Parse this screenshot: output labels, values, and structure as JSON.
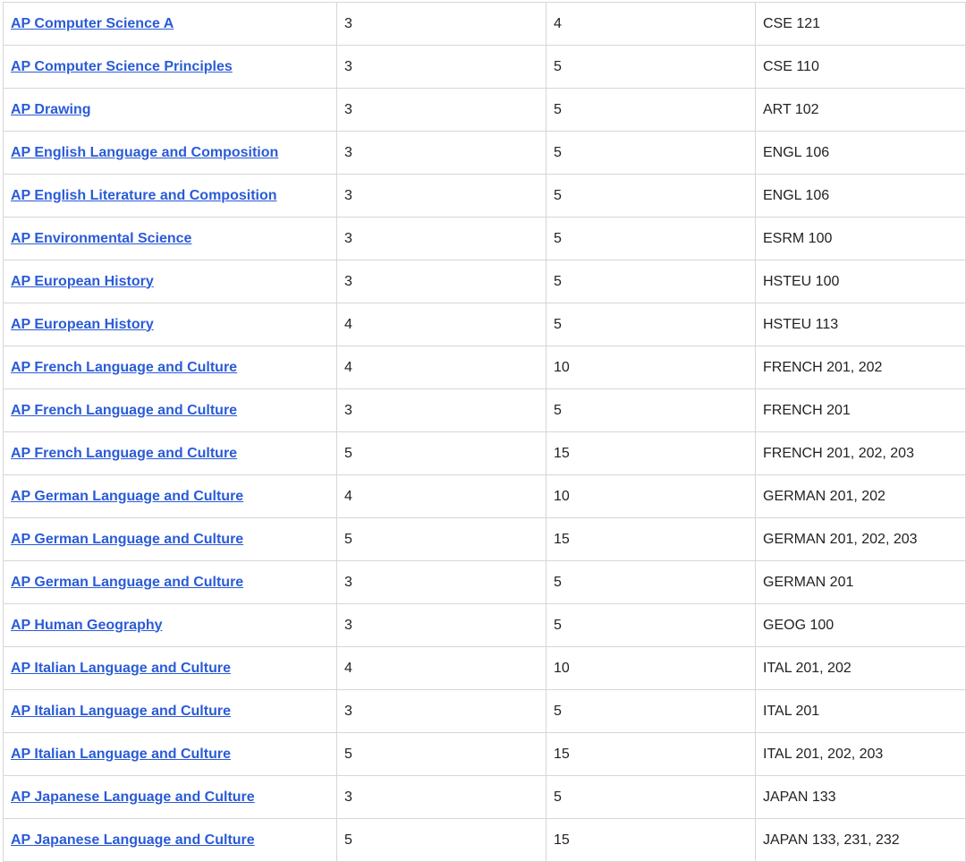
{
  "table": {
    "rows": [
      {
        "exam": "AP Computer Science A",
        "score": "3",
        "credits": "4",
        "courses": "CSE 121"
      },
      {
        "exam": "AP Computer Science Principles",
        "score": "3",
        "credits": "5",
        "courses": "CSE 110"
      },
      {
        "exam": "AP Drawing",
        "score": "3",
        "credits": "5",
        "courses": "ART 102"
      },
      {
        "exam": "AP English Language and Composition",
        "score": "3",
        "credits": "5",
        "courses": "ENGL 106"
      },
      {
        "exam": "AP English Literature and Composition",
        "score": "3",
        "credits": "5",
        "courses": "ENGL 106"
      },
      {
        "exam": "AP Environmental Science",
        "score": "3",
        "credits": "5",
        "courses": "ESRM 100"
      },
      {
        "exam": "AP European History",
        "score": "3",
        "credits": "5",
        "courses": "HSTEU 100"
      },
      {
        "exam": "AP European History",
        "score": "4",
        "credits": "5",
        "courses": "HSTEU 113"
      },
      {
        "exam": "AP French Language and Culture",
        "score": "4",
        "credits": "10",
        "courses": "FRENCH 201, 202"
      },
      {
        "exam": "AP French Language and Culture",
        "score": "3",
        "credits": "5",
        "courses": "FRENCH 201"
      },
      {
        "exam": "AP French Language and Culture",
        "score": "5",
        "credits": "15",
        "courses": "FRENCH 201, 202, 203"
      },
      {
        "exam": "AP German Language and Culture",
        "score": "4",
        "credits": "10",
        "courses": "GERMAN 201, 202"
      },
      {
        "exam": "AP German Language and Culture",
        "score": "5",
        "credits": "15",
        "courses": "GERMAN 201, 202, 203"
      },
      {
        "exam": "AP German Language and Culture",
        "score": "3",
        "credits": "5",
        "courses": "GERMAN 201"
      },
      {
        "exam": "AP Human Geography",
        "score": "3",
        "credits": "5",
        "courses": "GEOG 100"
      },
      {
        "exam": "AP Italian Language and Culture",
        "score": "4",
        "credits": "10",
        "courses": "ITAL 201, 202"
      },
      {
        "exam": "AP Italian Language and Culture",
        "score": "3",
        "credits": "5",
        "courses": "ITAL 201"
      },
      {
        "exam": "AP Italian Language and Culture",
        "score": "5",
        "credits": "15",
        "courses": "ITAL 201, 202, 203"
      },
      {
        "exam": "AP Japanese Language and Culture",
        "score": "3",
        "credits": "5",
        "courses": "JAPAN 133"
      },
      {
        "exam": "AP Japanese Language and Culture",
        "score": "5",
        "credits": "15",
        "courses": "JAPAN 133, 231, 232"
      }
    ]
  },
  "colors": {
    "link": "#2a5bd7",
    "text": "#222222",
    "border": "#d6d6d6"
  }
}
